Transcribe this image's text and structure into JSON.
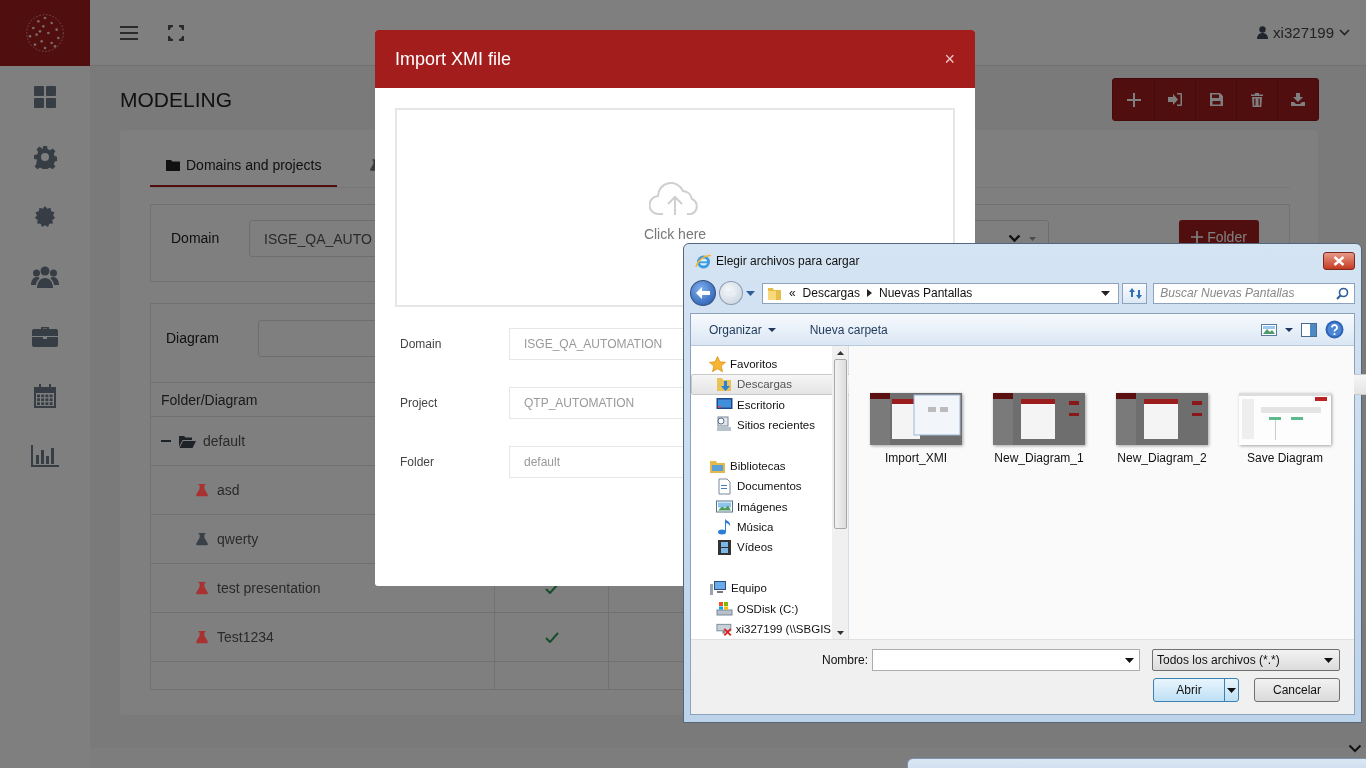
{
  "header": {
    "user": "xi327199"
  },
  "page": {
    "title": "MODELING",
    "tabs": [
      {
        "label": "Domains and projects",
        "selected": true
      },
      {
        "selected": false
      }
    ],
    "domain": {
      "label": "Domain",
      "value": "ISGE_QA_AUTO"
    },
    "folder_button": "Folder",
    "diagram": {
      "label": "Diagram"
    },
    "tree_table": {
      "columns": [
        "Folder/Diagram"
      ],
      "rows": [
        {
          "name": "default",
          "expanded": true,
          "children": [
            {
              "name": "asd",
              "color": "#a83232"
            },
            {
              "name": "qwerty",
              "color": "#3a4048"
            },
            {
              "name": "test presentation",
              "color": "#a83232",
              "checked": true
            },
            {
              "name": "Test1234",
              "color": "#a83232",
              "checked": true
            }
          ]
        }
      ]
    }
  },
  "modal": {
    "title": "Import XMI file",
    "close": "×",
    "dropzone": "Click here",
    "fields": [
      {
        "label": "Domain",
        "value": "ISGE_QA_AUTOMATION"
      },
      {
        "label": "Project",
        "value": "QTP_AUTOMATION"
      },
      {
        "label": "Folder",
        "value": "default"
      }
    ]
  },
  "file_dialog": {
    "title": "Elegir archivos para cargar",
    "overflow": "«",
    "breadcrumb": [
      "Descargas",
      "Nuevas Pantallas"
    ],
    "search": {
      "placeholder": "Buscar Nuevas Pantallas"
    },
    "toolbar": {
      "organize": "Organizar",
      "new_folder": "Nueva carpeta"
    },
    "nav": [
      {
        "label": "Favoritos",
        "selected": false,
        "children": [
          {
            "label": "Descargas",
            "selected": true
          },
          {
            "label": "Escritorio",
            "selected": false
          },
          {
            "label": "Sitios recientes",
            "selected": false
          }
        ]
      },
      {
        "label": "Bibliotecas",
        "selected": false,
        "children": [
          {
            "label": "Documentos",
            "selected": false
          },
          {
            "label": "Imágenes",
            "selected": false
          },
          {
            "label": "Música",
            "selected": false
          },
          {
            "label": "Vídeos",
            "selected": false
          }
        ]
      },
      {
        "label": "Equipo",
        "selected": false,
        "children": [
          {
            "label": "OSDisk (C:)",
            "selected": false
          },
          {
            "label": "xi327199 (\\\\SBGIS",
            "selected": false
          }
        ]
      }
    ],
    "files": [
      {
        "name": "Import_XMI"
      },
      {
        "name": "New_Diagram_1"
      },
      {
        "name": "New_Diagram_2"
      },
      {
        "name": "Save Diagram"
      }
    ],
    "filename": {
      "label": "Nombre:"
    },
    "filter": "Todos los archivos (*.*)",
    "buttons": [
      "Abrir",
      "Cancelar"
    ]
  }
}
